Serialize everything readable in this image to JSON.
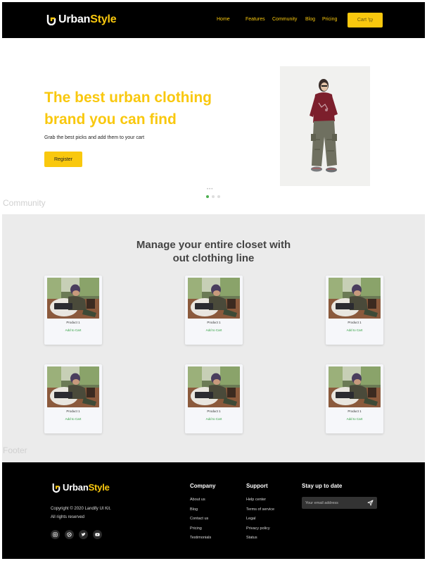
{
  "brand": {
    "name_part1": "Urban",
    "name_part2": "Style",
    "accent_color": "#f9c80e"
  },
  "nav": {
    "items": [
      "Home",
      "Features",
      "Community",
      "Blog",
      "Pricing"
    ],
    "cart_label": "Cart",
    "cart_icon": "cart-icon"
  },
  "hero": {
    "title": "The best urban clothing brand you can find",
    "subtitle": "Grab the best picks and add them to your cart",
    "register_label": "Register",
    "slides_total": 3,
    "active_slide": 1
  },
  "section_labels": {
    "community": "Community",
    "footer": "Footer"
  },
  "community": {
    "title": "Manage your entire closet with out clothing line",
    "products": [
      {
        "name": "Product 1",
        "action": "Add to Cart"
      },
      {
        "name": "Product 1",
        "action": "Add to Cart"
      },
      {
        "name": "Product 1",
        "action": "Add to Cart"
      },
      {
        "name": "Product 1",
        "action": "Add to Cart"
      },
      {
        "name": "Product 1",
        "action": "Add to Cart"
      },
      {
        "name": "Product 1",
        "action": "Add to Cart"
      }
    ],
    "action_color": "#2e9e3e"
  },
  "footer": {
    "copyright_line1": "Copyright © 2020 Landify UI Kit.",
    "copyright_line2": "All rights reserved",
    "socials": [
      "instagram-icon",
      "dribbble-icon",
      "twitter-icon",
      "youtube-icon"
    ],
    "company": {
      "heading": "Company",
      "links": [
        "About us",
        "Blog",
        "Contact us",
        "Pricing",
        "Testimonials"
      ]
    },
    "support": {
      "heading": "Support",
      "links": [
        "Help center",
        "Terms of service",
        "Legal",
        "Privacy policy",
        "Status"
      ]
    },
    "newsletter": {
      "heading": "Stay up to date",
      "placeholder": "Your email address",
      "send_icon": "send-icon"
    }
  }
}
